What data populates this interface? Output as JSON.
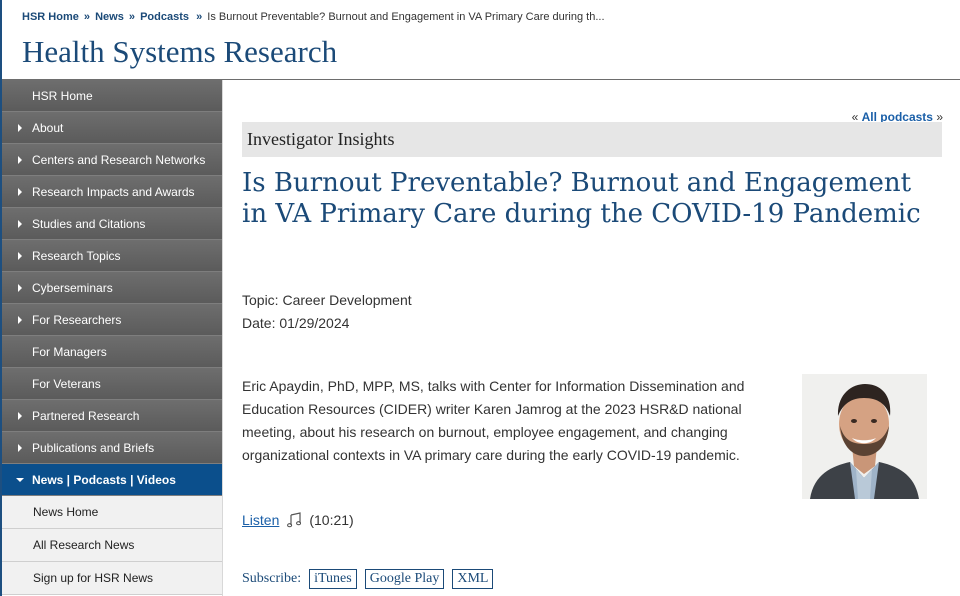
{
  "breadcrumb": {
    "items": [
      "HSR Home",
      "News",
      "Podcasts"
    ],
    "current": "Is Burnout Preventable? Burnout and Engagement in VA Primary Care during th..."
  },
  "site_title": "Health Systems Research",
  "sidebar": {
    "items": [
      {
        "label": "HSR Home",
        "arrow": false
      },
      {
        "label": "About",
        "arrow": true
      },
      {
        "label": "Centers and Research Networks",
        "arrow": true
      },
      {
        "label": "Research Impacts and Awards",
        "arrow": true
      },
      {
        "label": "Studies and Citations",
        "arrow": true
      },
      {
        "label": "Research Topics",
        "arrow": true
      },
      {
        "label": "Cyberseminars",
        "arrow": true
      },
      {
        "label": "For Researchers",
        "arrow": true
      },
      {
        "label": "For Managers",
        "arrow": false
      },
      {
        "label": "For Veterans",
        "arrow": false
      },
      {
        "label": "Partnered Research",
        "arrow": true
      },
      {
        "label": "Publications and Briefs",
        "arrow": true
      },
      {
        "label": "News | Podcasts | Videos",
        "arrow": true,
        "active": true
      }
    ],
    "subitems": [
      "News Home",
      "All Research News",
      "Sign up for HSR News"
    ]
  },
  "all_podcasts": {
    "prefix": "«",
    "label": "All podcasts",
    "suffix": "»"
  },
  "section": "Investigator Insights",
  "title": "Is Burnout Preventable? Burnout and Engagement in VA Primary Care during the COVID-19 Pandemic",
  "topic": "Topic: Career Development",
  "date": "Date: 01/29/2024",
  "description": "Eric Apaydin, PhD, MPP, MS, talks with Center for Information Dissemination and Education Resources (CIDER) writer Karen Jamrog at the 2023 HSR&D national meeting, about his research on burnout, employee engagement, and changing organizational contexts in VA primary care during the early COVID-19 pandemic.",
  "listen": {
    "label": "Listen",
    "icon": "music-note-icon",
    "duration": "(10:21)"
  },
  "subscribe": {
    "label": "Subscribe:",
    "options": [
      "iTunes",
      "Google Play",
      "XML"
    ]
  },
  "colors": {
    "brand_blue": "#1b4a78",
    "nav_gray": "#5f5f5f",
    "active_blue": "#0b4f8c"
  }
}
